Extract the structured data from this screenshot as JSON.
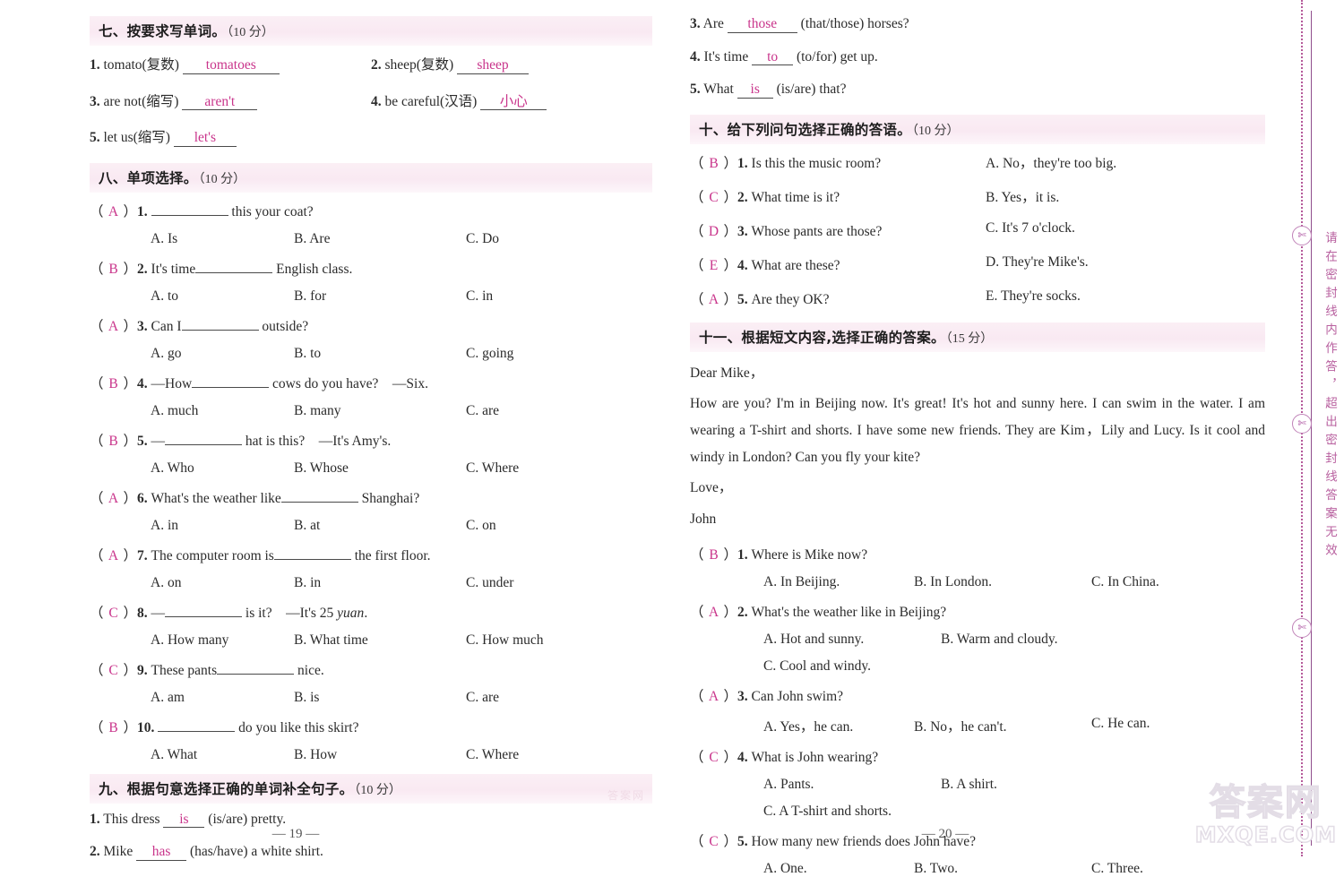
{
  "sections": {
    "s7": {
      "title": "七、按要求写单词。",
      "points": "（10 分）",
      "items": [
        {
          "num": "1.",
          "prompt": "tomato(复数)",
          "answer": "tomatoes"
        },
        {
          "num": "2.",
          "prompt": "sheep(复数)",
          "answer": "sheep"
        },
        {
          "num": "3.",
          "prompt": "are not(缩写)",
          "answer": "aren't"
        },
        {
          "num": "4.",
          "prompt": "be careful(汉语)",
          "answer": "小心"
        },
        {
          "num": "5.",
          "prompt": "let us(缩写)",
          "answer": "let's"
        }
      ]
    },
    "s8": {
      "title": "八、单项选择。",
      "points": "（10 分）",
      "questions": [
        {
          "pick": "A",
          "num": "1.",
          "pre": "",
          "post": "this your coat?",
          "tail": "",
          "a": "A. Is",
          "b": "B. Are",
          "c": "C. Do"
        },
        {
          "pick": "B",
          "num": "2.",
          "pre": "It's time",
          "post": "English class.",
          "tail": "",
          "a": "A. to",
          "b": "B. for",
          "c": "C. in"
        },
        {
          "pick": "A",
          "num": "3.",
          "pre": "Can I",
          "post": "outside?",
          "tail": "",
          "a": "A. go",
          "b": "B. to",
          "c": "C. going"
        },
        {
          "pick": "B",
          "num": "4.",
          "pre": "—How",
          "post": "cows do you have?",
          "tail": "—Six.",
          "a": "A. much",
          "b": "B. many",
          "c": "C. are"
        },
        {
          "pick": "B",
          "num": "5.",
          "pre": "—",
          "post": "hat is this?",
          "tail": "—It's Amy's.",
          "a": "A. Who",
          "b": "B. Whose",
          "c": "C. Where"
        },
        {
          "pick": "A",
          "num": "6.",
          "pre": "What's the weather like",
          "post": "Shanghai?",
          "tail": "",
          "a": "A. in",
          "b": "B. at",
          "c": "C. on"
        },
        {
          "pick": "A",
          "num": "7.",
          "pre": "The computer room is",
          "post": "the first floor.",
          "tail": "",
          "a": "A. on",
          "b": "B. in",
          "c": "C. under"
        },
        {
          "pick": "C",
          "num": "8.",
          "pre": "—",
          "post": "is it?",
          "tail": "—It's 25 yuan.",
          "a": "A. How many",
          "b": "B. What time",
          "c": "C. How much"
        },
        {
          "pick": "C",
          "num": "9.",
          "pre": "These pants",
          "post": "nice.",
          "tail": "",
          "a": "A. am",
          "b": "B. is",
          "c": "C. are"
        },
        {
          "pick": "B",
          "num": "10.",
          "pre": "",
          "post": "do you like this skirt?",
          "tail": "",
          "a": "A. What",
          "b": "B. How",
          "c": "C. Where"
        }
      ]
    },
    "s9": {
      "title": "九、根据句意选择正确的单词补全句子。",
      "points": "（10 分）",
      "watermark": "答案网",
      "items": [
        {
          "num": "1.",
          "pre": "This dress",
          "answer": "is",
          "post": "(is/are) pretty."
        },
        {
          "num": "2.",
          "pre": "Mike",
          "answer": "has",
          "post": "(has/have) a white shirt."
        },
        {
          "num": "3.",
          "pre": "Are",
          "answer": "those",
          "post": "(that/those) horses?"
        },
        {
          "num": "4.",
          "pre": "It's time",
          "answer": "to",
          "post": "(to/for) get up."
        },
        {
          "num": "5.",
          "pre": "What",
          "answer": "is",
          "post": "(is/are) that?"
        }
      ]
    },
    "s10": {
      "title": "十、给下列问句选择正确的答语。",
      "points": "（10 分）",
      "rows": [
        {
          "pick": "B",
          "num": "1.",
          "question": "Is this the music room?",
          "answer": "A. No，they're too big."
        },
        {
          "pick": "C",
          "num": "2.",
          "question": "What time is it?",
          "answer": "B. Yes，it is."
        },
        {
          "pick": "D",
          "num": "3.",
          "question": "Whose pants are those?",
          "answer": "C. It's 7 o'clock."
        },
        {
          "pick": "E",
          "num": "4.",
          "question": "What are these?",
          "answer": "D. They're Mike's."
        },
        {
          "pick": "A",
          "num": "5.",
          "question": "Are they OK?",
          "answer": "E. They're socks."
        }
      ]
    },
    "s11": {
      "title": "十一、根据短文内容,选择正确的答案。",
      "points": "（15 分）",
      "passage": {
        "salutation": "Dear Mike，",
        "body": "How are you?  I'm in Beijing now. It's great! It's hot and sunny here. I can swim in the water. I am wearing a T-shirt and shorts. I have some new friends. They are Kim，Lily and Lucy. Is it cool and windy in London? Can you fly your kite?",
        "closing": "Love，",
        "signature": "John"
      },
      "questions": [
        {
          "pick": "B",
          "num": "1.",
          "stem": "Where is Mike now?",
          "a": "A. In Beijing.",
          "b": "B. In London.",
          "c": "C. In China.",
          "wrap": false
        },
        {
          "pick": "A",
          "num": "2.",
          "stem": "What's the weather like in Beijing?",
          "a": "A. Hot and sunny.",
          "b": "B. Warm and cloudy.",
          "c": "C. Cool and windy.",
          "wrap": true
        },
        {
          "pick": "A",
          "num": "3.",
          "stem": "Can John swim?",
          "a": "A. Yes，he can.",
          "b": "B. No，he can't.",
          "c": "C. He can.",
          "wrap": false
        },
        {
          "pick": "C",
          "num": "4.",
          "stem": "What is John wearing?",
          "a": "A. Pants.",
          "b": "B. A shirt.",
          "c": "C. A T-shirt and shorts.",
          "wrap": true
        },
        {
          "pick": "C",
          "num": "5.",
          "stem": "How many new friends does John have?",
          "a": "A. One.",
          "b": "B. Two.",
          "c": "C. Three.",
          "wrap": false
        }
      ]
    }
  },
  "page_numbers": {
    "left": "— 19 —",
    "right": "— 20 —"
  },
  "binding": {
    "vertical_text": "请在密封线内作答，超出密封线答案无效",
    "seal_glyph": "✄"
  },
  "watermark": {
    "cn": "答案网",
    "en": "MXQE.COM"
  },
  "colors": {
    "answer_pink": "#c9348b",
    "header_bg": "#f9e9f2",
    "binding_purple": "#b8609f"
  }
}
